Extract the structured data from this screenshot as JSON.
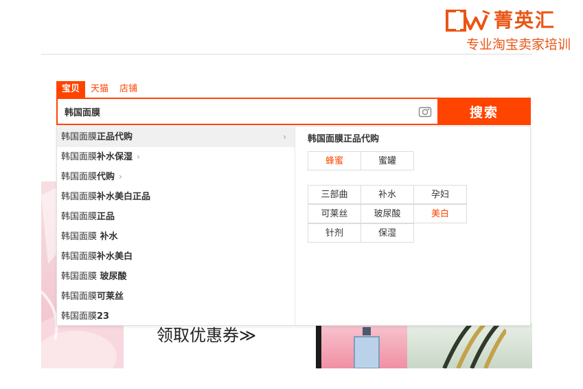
{
  "brand": {
    "name": "菁英汇",
    "slogan": "专业淘宝卖家培训",
    "color": "#ea5514"
  },
  "search": {
    "tabs": [
      {
        "label": "宝贝",
        "active": true
      },
      {
        "label": "天猫",
        "active": false
      },
      {
        "label": "店铺",
        "active": false
      }
    ],
    "query": "韩国面膜",
    "button_label": "搜索",
    "accent": "#ff4400"
  },
  "suggestions": [
    {
      "keyword": "韩国面膜",
      "extra": "正品代购",
      "chevron": "far",
      "hover": true
    },
    {
      "keyword": "韩国面膜",
      "extra": "补水保湿",
      "chevron": "near",
      "hover": false
    },
    {
      "keyword": "韩国面膜",
      "extra": "代购",
      "chevron": "near",
      "hover": false
    },
    {
      "keyword": "韩国面膜",
      "extra": "补水美白正品",
      "chevron": "none",
      "hover": false
    },
    {
      "keyword": "韩国面膜",
      "extra": "正品",
      "chevron": "none",
      "hover": false
    },
    {
      "keyword": "韩国面膜",
      "extra": " 补水",
      "chevron": "none",
      "hover": false
    },
    {
      "keyword": "韩国面膜",
      "extra": "补水美白",
      "chevron": "none",
      "hover": false
    },
    {
      "keyword": "韩国面膜",
      "extra": " 玻尿酸",
      "chevron": "none",
      "hover": false
    },
    {
      "keyword": "韩国面膜",
      "extra": "可莱丝",
      "chevron": "none",
      "hover": false
    },
    {
      "keyword": "韩国面膜",
      "extra": "23",
      "chevron": "none",
      "hover": false
    }
  ],
  "detail": {
    "title": "韩国面膜正品代购",
    "group1": [
      {
        "label": "蜂蜜",
        "highlight": true
      },
      {
        "label": "蜜罐",
        "highlight": false
      }
    ],
    "group2": [
      {
        "label": "三部曲",
        "highlight": false
      },
      {
        "label": "补水",
        "highlight": false
      },
      {
        "label": "孕妇",
        "highlight": false
      },
      {
        "label": "可莱丝",
        "highlight": false
      },
      {
        "label": "玻尿酸",
        "highlight": false
      },
      {
        "label": "美白",
        "highlight": true
      },
      {
        "label": "针剂",
        "highlight": false
      },
      {
        "label": "保湿",
        "highlight": false
      }
    ]
  },
  "banner": {
    "coupon_text": "领取优惠券≫"
  },
  "icons": {
    "camera": "camera-icon",
    "chevron": "chevron-right-icon",
    "logo": "brand-logo-icon"
  }
}
